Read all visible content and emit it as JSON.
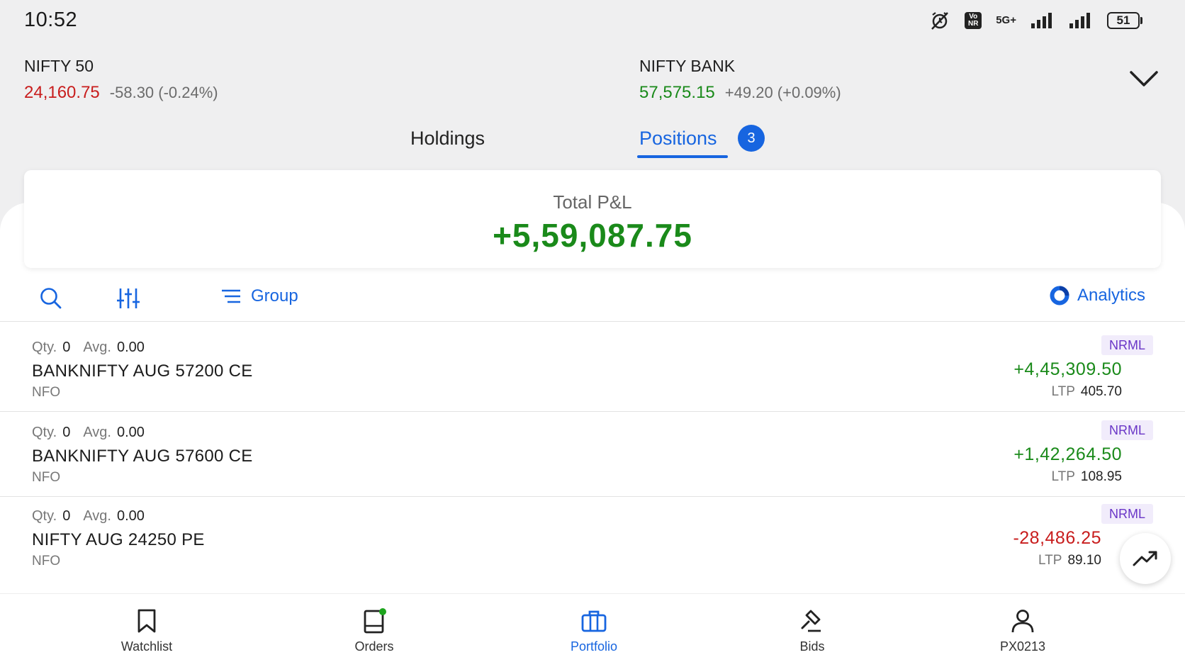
{
  "status_bar": {
    "time": "10:52",
    "network": "5G+",
    "volte": [
      "Vo",
      "NR"
    ],
    "battery": "51"
  },
  "indices": [
    {
      "name": "NIFTY 50",
      "price": "24,160.75",
      "change": "-58.30 (-0.24%)",
      "direction": "down"
    },
    {
      "name": "NIFTY BANK",
      "price": "57,575.15",
      "change": "+49.20 (+0.09%)",
      "direction": "up"
    }
  ],
  "tabs": {
    "holdings": "Holdings",
    "positions": "Positions",
    "positions_count": "3"
  },
  "pnl": {
    "label": "Total P&L",
    "value": "+5,59,087.75"
  },
  "toolbar": {
    "group_label": "Group",
    "analytics_label": "Analytics"
  },
  "positions": [
    {
      "qty_label": "Qty.",
      "qty": "0",
      "avg_label": "Avg.",
      "avg": "0.00",
      "name": "BANKNIFTY AUG 57200 CE",
      "exchange": "NFO",
      "product": "NRML",
      "pnl": "+4,45,309.50",
      "ltp_label": "LTP",
      "ltp": "405.70"
    },
    {
      "qty_label": "Qty.",
      "qty": "0",
      "avg_label": "Avg.",
      "avg": "0.00",
      "name": "BANKNIFTY AUG 57600 CE",
      "exchange": "NFO",
      "product": "NRML",
      "pnl": "+1,42,264.50",
      "ltp_label": "LTP",
      "ltp": "108.95"
    },
    {
      "qty_label": "Qty.",
      "qty": "0",
      "avg_label": "Avg.",
      "avg": "0.00",
      "name": "NIFTY AUG 24250 PE",
      "exchange": "NFO",
      "product": "NRML",
      "pnl": "-28,486.25",
      "ltp_label": "LTP",
      "ltp": "89.10"
    }
  ],
  "bottom_nav": [
    {
      "label": "Watchlist",
      "icon": "bookmark-icon"
    },
    {
      "label": "Orders",
      "icon": "orders-book-icon"
    },
    {
      "label": "Portfolio",
      "icon": "briefcase-icon"
    },
    {
      "label": "Bids",
      "icon": "gavel-icon"
    },
    {
      "label": "PX0213",
      "icon": "user-icon"
    }
  ],
  "colors": {
    "accent": "#1765e0",
    "profit": "#1a8a1a",
    "loss": "#c81d1d",
    "tag_bg": "#f1ecfb",
    "tag_text": "#6a36c7"
  }
}
